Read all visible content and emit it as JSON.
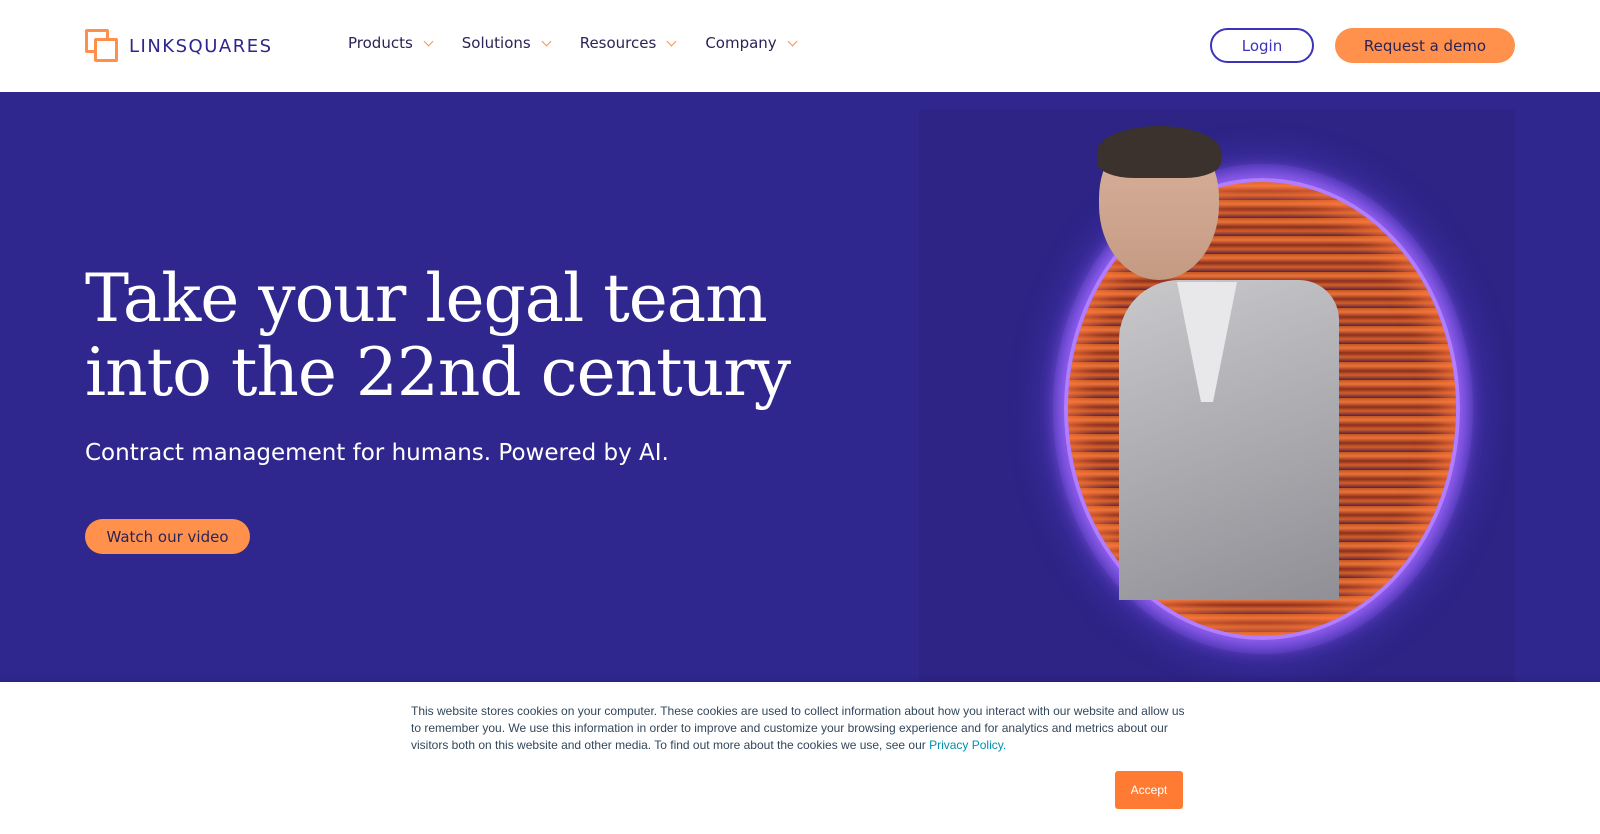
{
  "brand": {
    "name": "LINKSQUARES",
    "accent": "#ff914d",
    "primary": "#30278e"
  },
  "header": {
    "nav": [
      {
        "label": "Products",
        "icon": "chevron-down-icon"
      },
      {
        "label": "Solutions",
        "icon": "chevron-down-icon"
      },
      {
        "label": "Resources",
        "icon": "chevron-down-icon"
      },
      {
        "label": "Company",
        "icon": "chevron-down-icon"
      }
    ],
    "login_label": "Login",
    "demo_label": "Request a demo"
  },
  "hero": {
    "headline_line1": "Take your legal team",
    "headline_line2": "into the 22nd century",
    "subheadline": "Contract management for humans. Powered by AI.",
    "video_button_label": "Watch our video"
  },
  "cookie_banner": {
    "text": "This website stores cookies on your computer. These cookies are used to collect information about how you interact with our website and allow us to remember you. We use this information in order to improve and customize your browsing experience and for analytics and metrics about our visitors both on this website and other media. To find out more about the cookies we use, see our ",
    "link_label": "Privacy Policy.",
    "accept_label": "Accept"
  }
}
